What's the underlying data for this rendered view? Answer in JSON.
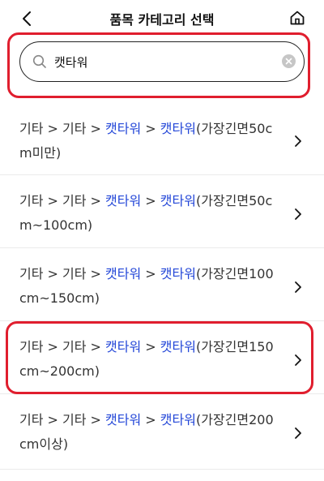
{
  "header": {
    "title": "품목 카테고리 선택",
    "back_icon": "chevron-left-icon",
    "home_icon": "home-icon"
  },
  "search": {
    "value": "캣타워",
    "placeholder": "",
    "search_icon": "search-icon",
    "clear_icon": "clear-icon"
  },
  "colors": {
    "highlight_text": "#2548d8",
    "annotation_border": "#e01e2e"
  },
  "results": [
    {
      "path_prefix": "기타 > 기타 > ",
      "match1": "캣타워",
      "separator": " > ",
      "match2": "캣타워",
      "suffix": "(가장긴면50cm미만)"
    },
    {
      "path_prefix": "기타 > 기타 > ",
      "match1": "캣타워",
      "separator": " > ",
      "match2": "캣타워",
      "suffix": "(가장긴면50cm~100cm)"
    },
    {
      "path_prefix": "기타 > 기타 > ",
      "match1": "캣타워",
      "separator": " > ",
      "match2": "캣타워",
      "suffix": "(가장긴면100cm~150cm)"
    },
    {
      "path_prefix": "기타 > 기타 > ",
      "match1": "캣타워",
      "separator": " > ",
      "match2": "캣타워",
      "suffix": "(가장긴면150cm~200cm)"
    },
    {
      "path_prefix": "기타 > 기타 > ",
      "match1": "캣타워",
      "separator": " > ",
      "match2": "캣타워",
      "suffix": "(가장긴면200cm이상)"
    }
  ]
}
